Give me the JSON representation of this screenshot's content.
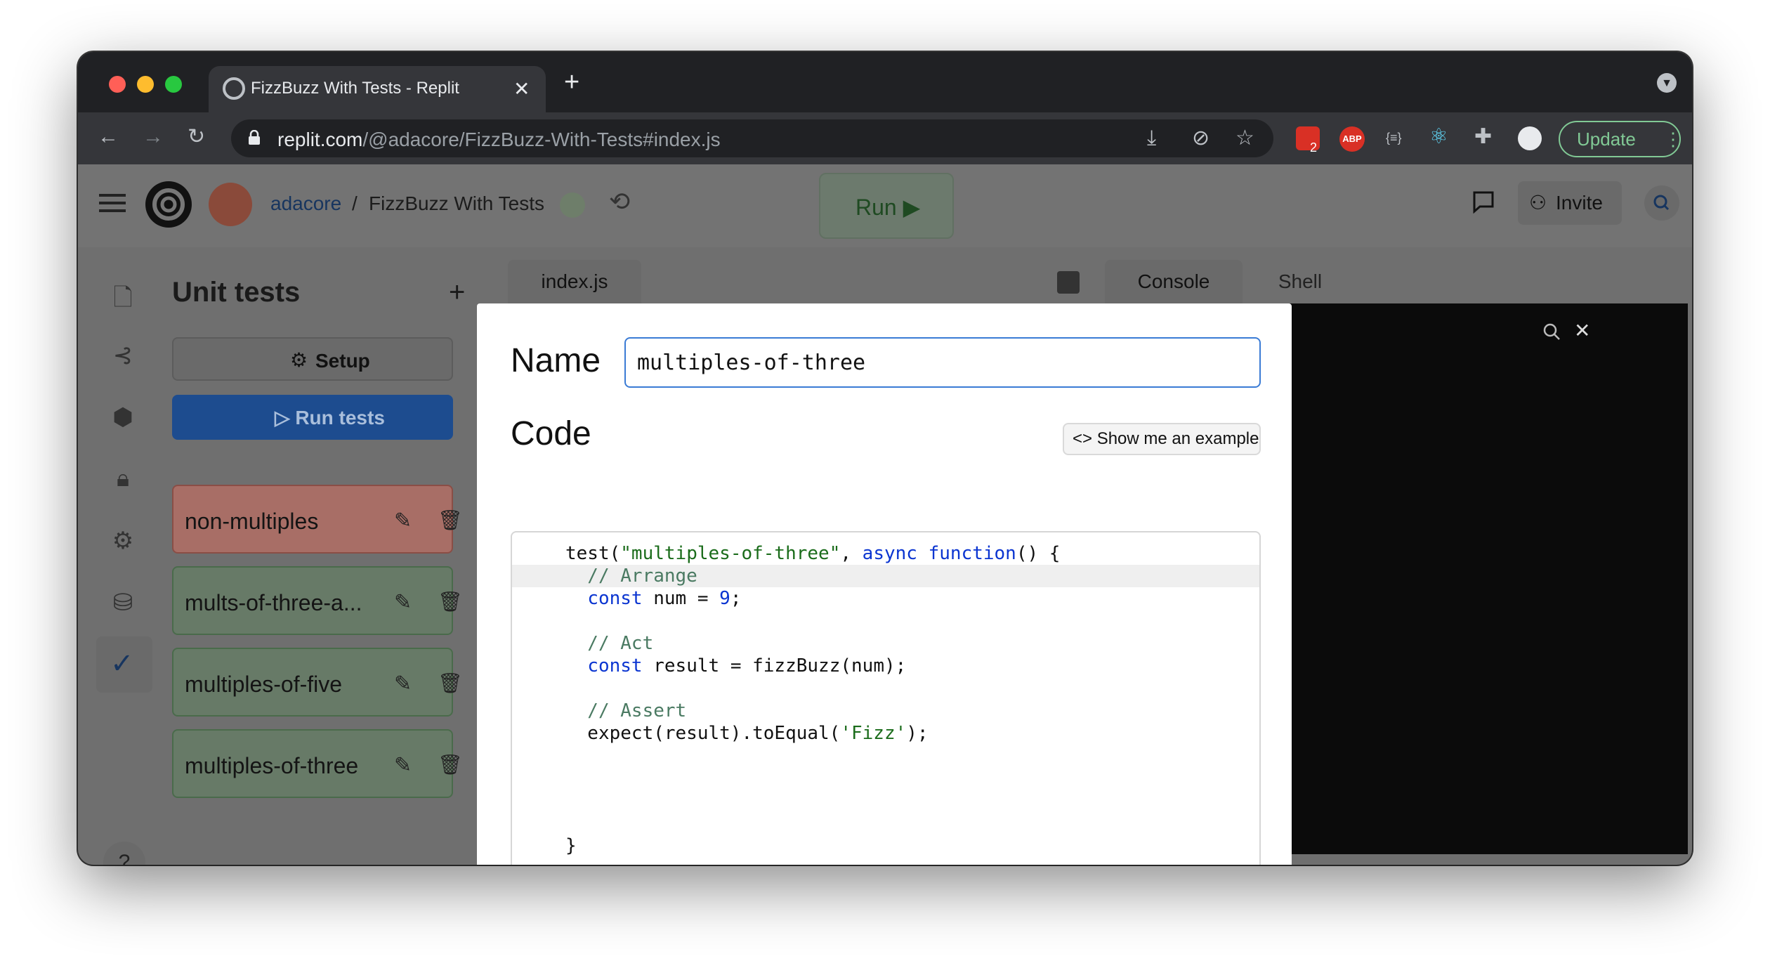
{
  "browser": {
    "tab_title": "FizzBuzz With Tests - Replit",
    "url_host": "replit.com",
    "url_path": "/@adacore/FizzBuzz-With-Tests#index.js",
    "update_label": "Update",
    "extension_badge": "2",
    "abp_label": "ABP",
    "json_ext_label": "{≡}"
  },
  "app": {
    "user": "adacore",
    "separator": "/",
    "repl_name": "FizzBuzz With Tests",
    "run_label": "Run ▶",
    "invite_label": "Invite"
  },
  "sidebar": {
    "title": "Unit tests",
    "add_label": "+",
    "setup_label": "Setup",
    "run_tests_label": "▷ Run tests",
    "tests": [
      {
        "name": "non-multiples",
        "status": "failed"
      },
      {
        "name": "mults-of-three-a...",
        "status": "passed"
      },
      {
        "name": "multiples-of-five",
        "status": "passed"
      },
      {
        "name": "multiples-of-three",
        "status": "passed"
      }
    ],
    "help_label": "?"
  },
  "editor": {
    "file_tab": "index.js",
    "console_tab": "Console",
    "shell_tab": "Shell"
  },
  "modal": {
    "name_label": "Name",
    "name_value": "multiples-of-three",
    "code_label": "Code",
    "example_label": "<> Show me an example",
    "code_lines": [
      "test(\"multiples-of-three\", async function() {",
      "  // Arrange",
      "  const num = 9;",
      "",
      "  // Act",
      "  const result = fizzBuzz(num);",
      "",
      "  // Assert",
      "  expect(result).toEqual('Fizz');",
      "",
      "",
      "",
      "",
      "}"
    ]
  },
  "colors": {
    "accent_blue": "#1d4c8f",
    "test_failed": "#a86e66",
    "test_passed": "#677a67",
    "update_green": "#81c995"
  }
}
